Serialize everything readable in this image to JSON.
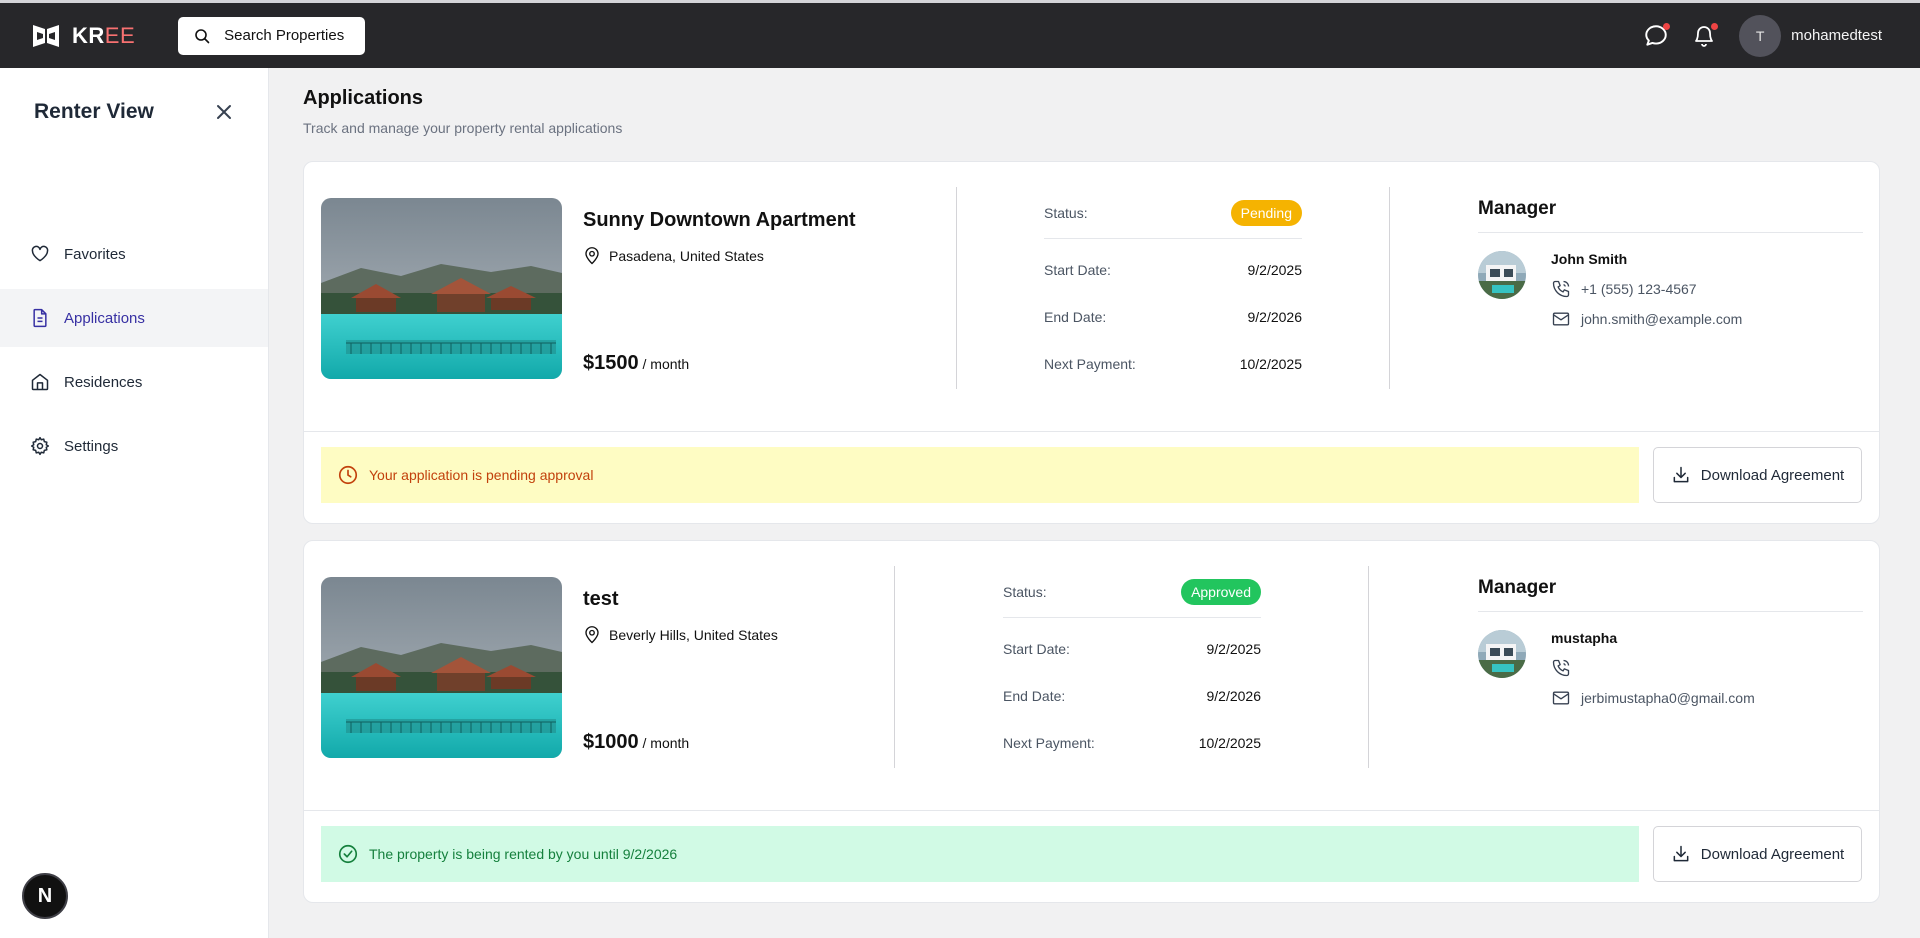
{
  "brand": {
    "name_primary": "KR",
    "name_accent": "EE",
    "accent_color": "#f87171"
  },
  "topbar": {
    "search_label": "Search Properties",
    "icons": [
      "logo-icon",
      "search-icon",
      "chat-icon",
      "bell-icon"
    ],
    "avatar_initial": "T",
    "username": "mohamedtest"
  },
  "sidebar": {
    "title": "Renter View",
    "items": [
      {
        "label": "Favorites",
        "icon": "heart-icon"
      },
      {
        "label": "Applications",
        "icon": "document-icon",
        "active": true
      },
      {
        "label": "Residences",
        "icon": "home-icon"
      },
      {
        "label": "Settings",
        "icon": "gear-icon"
      }
    ],
    "badge": "N"
  },
  "page": {
    "title": "Applications",
    "subtitle": "Track and manage your property rental applications"
  },
  "labels": {
    "status": "Status:",
    "start_date": "Start Date:",
    "end_date": "End Date:",
    "next_payment": "Next Payment:",
    "manager": "Manager",
    "per_month": "/ month",
    "download": "Download Agreement"
  },
  "applications": [
    {
      "name": "Sunny Downtown Apartment",
      "location": "Pasadena, United States",
      "price": "$1500",
      "status": "Pending",
      "status_color": "#f5b301",
      "start_date": "9/2/2025",
      "end_date": "9/2/2026",
      "next_payment": "10/2/2025",
      "manager": {
        "name": "John Smith",
        "phone": "+1 (555) 123-4567",
        "email": "john.smith@example.com"
      },
      "notice": "Your application is pending approval"
    },
    {
      "name": "test",
      "location": "Beverly Hills, United States",
      "price": "$1000",
      "status": "Approved",
      "status_color": "#22c55e",
      "start_date": "9/2/2025",
      "end_date": "9/2/2026",
      "next_payment": "10/2/2025",
      "manager": {
        "name": "mustapha",
        "phone": "",
        "email": "jerbimustapha0@gmail.com"
      },
      "notice": "The property is being rented by you until 9/2/2026"
    }
  ]
}
